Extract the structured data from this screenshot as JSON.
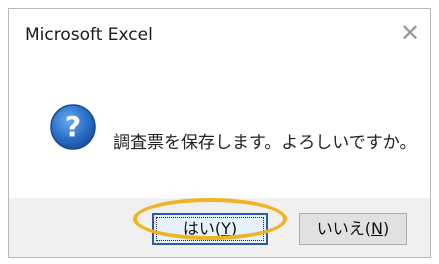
{
  "window": {
    "title": "Microsoft Excel"
  },
  "dialog": {
    "icon": "question-icon",
    "message": "調査票を保存します。よろしいですか。"
  },
  "buttons": {
    "yes_label": "はい(",
    "yes_key": "Y",
    "yes_close": ")",
    "no_label": "いいえ(",
    "no_key": "N",
    "no_close": ")"
  },
  "colors": {
    "highlight": "#f0b323",
    "icon_blue": "#2a6fc9"
  }
}
